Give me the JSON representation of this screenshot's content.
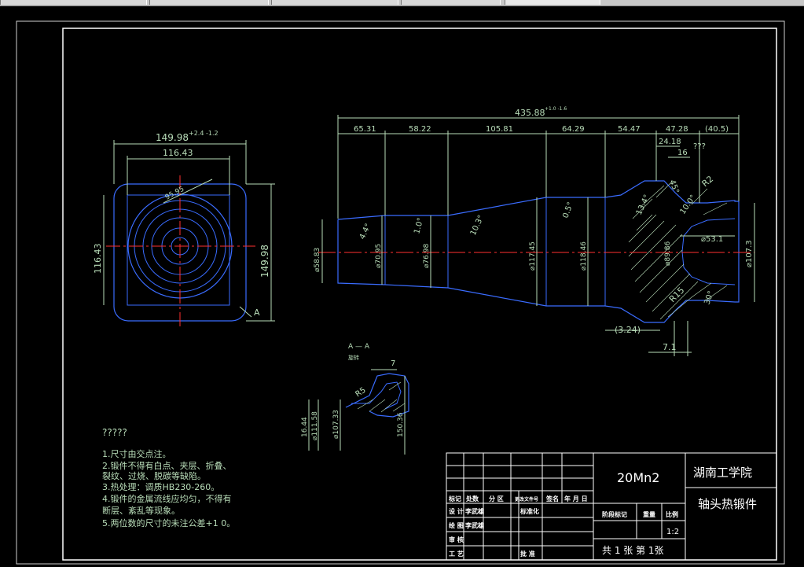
{
  "title_block": {
    "material": "20Mn2",
    "school": "湖南工学院",
    "part_name": "轴头热锻件",
    "scale": "1:2",
    "sheet": "共 1 张 第 1张",
    "headers": [
      "标记",
      "处数",
      "分 区",
      "更改文件号",
      "签名",
      "年 月 日"
    ],
    "roles": [
      "设 计",
      "审 核",
      "工 艺"
    ],
    "role_names": [
      "李武雄",
      "李武雄"
    ],
    "std": "标准化",
    "approve": "批 准",
    "stage": "阶段标记",
    "weight": "重量",
    "ratio": "比例",
    "drawn": "绘 图"
  },
  "notes": {
    "heading": "?????",
    "lines": [
      "1.尺寸由交点注。",
      "2.锻件不得有白点、夹层、折叠、",
      "裂纹、过烧、脱碳等缺陷。",
      "3.热处理：调质HB230-260。",
      "4.锻件的金属流线应均匀，不得有",
      "断层、紊乱等现象。",
      "5.两位数的尺寸的未注公差+1 0。"
    ]
  },
  "left_view": {
    "dim_top": "149.98",
    "tol_top": "+2.4 -1.2",
    "dim_inner": "116.43",
    "dim_left": "116.43",
    "dim_right": "149.98",
    "diag": "95.95",
    "section_mark": "A"
  },
  "main_view": {
    "overall": "435.88",
    "overall_tol": "+1.0 -1.6",
    "segments": [
      "65.31",
      "58.22",
      "105.81",
      "64.29",
      "54.47",
      "47.28",
      "(40.5)"
    ],
    "sub_dims": [
      "24.18",
      "16",
      "???"
    ],
    "diameters": [
      "⌀58.83",
      "⌀70.95",
      "⌀76.98",
      "⌀117.45",
      "⌀118.46",
      "⌀89.86",
      "⌀53.1",
      "⌀107.3"
    ],
    "angles": [
      "4.4°",
      "1.0°",
      "10.3°",
      "0.5°",
      "13.4°",
      "45°",
      "10.0°",
      "30°"
    ],
    "radii": [
      "R2",
      "R15"
    ],
    "bottom": [
      "(3.24)",
      "7.1"
    ]
  },
  "section_view": {
    "title": "A — A",
    "subtitle": "旋转",
    "dims": [
      "7",
      "R5",
      "16.44",
      "⌀111.58",
      "⌀107.33",
      "150.36"
    ]
  },
  "colors": {
    "background": "#000000",
    "geometry": "#3a6cff",
    "dimension": "#b8dcb8",
    "centerline": "#ff3030",
    "frame": "#ffffff"
  }
}
